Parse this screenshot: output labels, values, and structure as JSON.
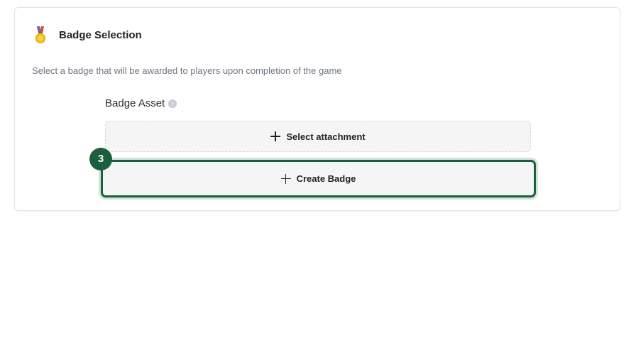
{
  "badge_selection": {
    "icon": "medal-icon",
    "title": "Badge Selection",
    "description": "Select a badge that will be awarded to players upon completion of the game",
    "field_label": "Badge Asset",
    "info_icon": "info-icon",
    "select_attachment_label": "Select attachment",
    "create_badge_label": "Create Badge",
    "step_number": "3"
  },
  "colors": {
    "accent": "#1c5e3d",
    "highlight": "#cfe6d6",
    "button_bg": "#f5f5f5",
    "muted_text": "#6e7681"
  }
}
